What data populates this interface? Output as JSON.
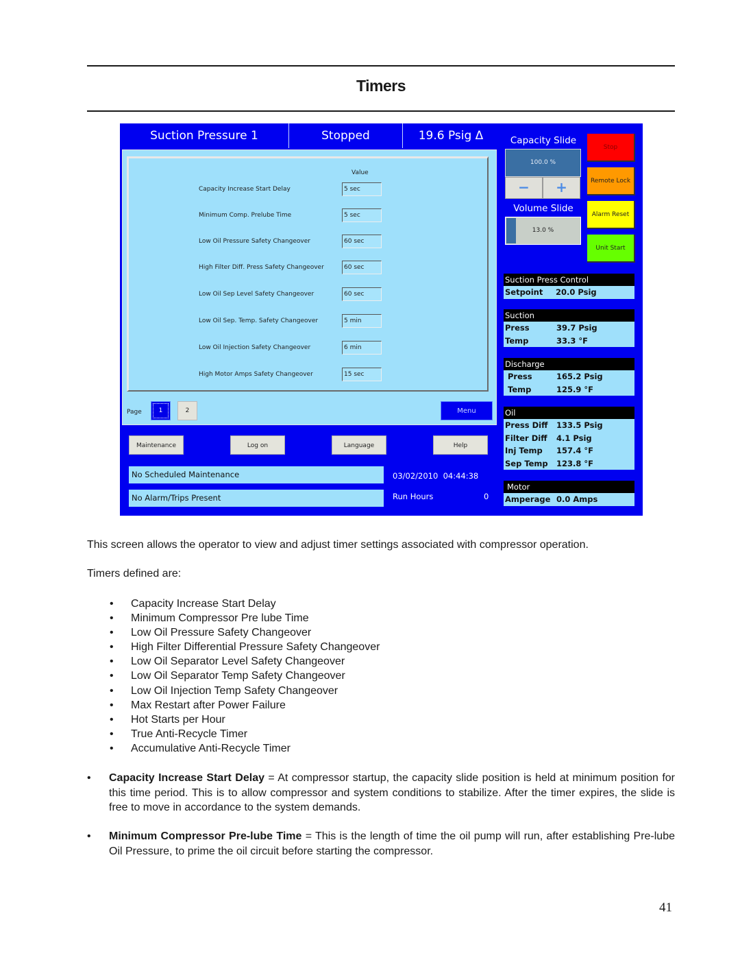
{
  "document": {
    "title": "Timers",
    "page_number": "41",
    "intro": "This screen allows the operator to view and adjust timer settings associated with compressor operation.",
    "list_intro": "Timers defined are:",
    "timers_list": [
      "Capacity Increase Start Delay",
      "Minimum Compressor Pre lube Time",
      "Low Oil Pressure Safety Changeover",
      "High Filter Differential Pressure Safety Changeover",
      "Low Oil Separator Level Safety Changeover",
      "Low Oil Separator Temp Safety Changeover",
      "Low Oil Injection Temp Safety Changeover",
      "Max Restart after Power Failure",
      "Hot Starts per Hour",
      "True Anti-Recycle Timer",
      "Accumulative Anti-Recycle Timer"
    ],
    "definitions": [
      {
        "term": "Capacity Increase Start Delay",
        "text": " = At compressor startup, the capacity slide position is held at minimum position for this time period. This is to allow compressor and system conditions to stabilize.  After the timer expires, the slide is free to move in accordance to the system demands."
      },
      {
        "term": "Minimum Compressor Pre-lube Time",
        "text": " = This is the length of time the oil pump will run, after establishing Pre-lube Oil Pressure, to prime the oil circuit before starting the compressor."
      }
    ],
    "bullet_glyph": "•"
  },
  "hmi": {
    "header": {
      "control_mode": "Suction Pressure 1",
      "status": "Stopped",
      "reading": "19.6 Psig Δ"
    },
    "timers_panel": {
      "value_header": "Value",
      "rows": [
        {
          "label": "Capacity Increase Start Delay",
          "value": "5 sec"
        },
        {
          "label": "Minimum Comp. Prelube Time",
          "value": "5 sec"
        },
        {
          "label": "Low Oil Pressure Safety Changeover",
          "value": "60 sec"
        },
        {
          "label": "High Filter Diff. Press Safety Changeover",
          "value": "60 sec"
        },
        {
          "label": "Low Oil Sep Level Safety Changeover",
          "value": "60 sec"
        },
        {
          "label": "Low Oil Sep. Temp. Safety Changeover",
          "value": "5 min"
        },
        {
          "label": "Low Oil Injection Safety Changeover",
          "value": "6 min"
        },
        {
          "label": "High Motor Amps Safety Changeover",
          "value": "15 sec"
        }
      ]
    },
    "pager": {
      "label": "Page",
      "pages": [
        "1",
        "2"
      ],
      "current": "1",
      "menu_label": "Menu"
    },
    "bottom_buttons": [
      "Maintenance",
      "Log on",
      "Language",
      "Help"
    ],
    "status": {
      "maintenance": "No Scheduled Maintenance",
      "alarms": "No Alarm/Trips Present",
      "datetime": "03/02/2010  04:44:38",
      "run_hours_label": "Run Hours",
      "run_hours_value": "0"
    },
    "capacity_slide": {
      "title": "Capacity Slide",
      "value": "100.0 %",
      "minus_icon": "−",
      "plus_icon": "+"
    },
    "volume_slide": {
      "title": "Volume Slide",
      "value": "13.0 %",
      "fraction": 0.13
    },
    "command_buttons": [
      {
        "label": "Stop",
        "color": "#ff0000"
      },
      {
        "label": "Remote Lock",
        "color": "#ff9900"
      },
      {
        "label": "Alarm Reset",
        "color": "#ffff00"
      },
      {
        "label": "Unit Start",
        "color": "#66ff00"
      }
    ],
    "groups": {
      "suction_control": {
        "title": "Suction Press Control",
        "rows": [
          {
            "k": "Setpoint",
            "v": "20.0 Psig"
          }
        ]
      },
      "suction": {
        "title": "Suction",
        "rows": [
          {
            "k": "Press",
            "v": "39.7 Psig"
          },
          {
            "k": "Temp",
            "v": "33.3 °F"
          }
        ]
      },
      "discharge": {
        "title": "Discharge",
        "rows": [
          {
            "k": "Press",
            "v": "165.2 Psig"
          },
          {
            "k": "Temp",
            "v": "125.9 °F"
          }
        ]
      },
      "oil": {
        "title": "Oil",
        "rows": [
          {
            "k": "Press Diff",
            "v": "133.5 Psig"
          },
          {
            "k": "Filter Diff",
            "v": "4.1 Psig"
          },
          {
            "k": "Inj Temp",
            "v": "157.4 °F"
          },
          {
            "k": "Sep Temp",
            "v": "123.8 °F"
          }
        ]
      },
      "motor": {
        "title": "Motor",
        "rows": [
          {
            "k": "Amperage",
            "v": "0.0 Amps"
          }
        ]
      }
    }
  }
}
